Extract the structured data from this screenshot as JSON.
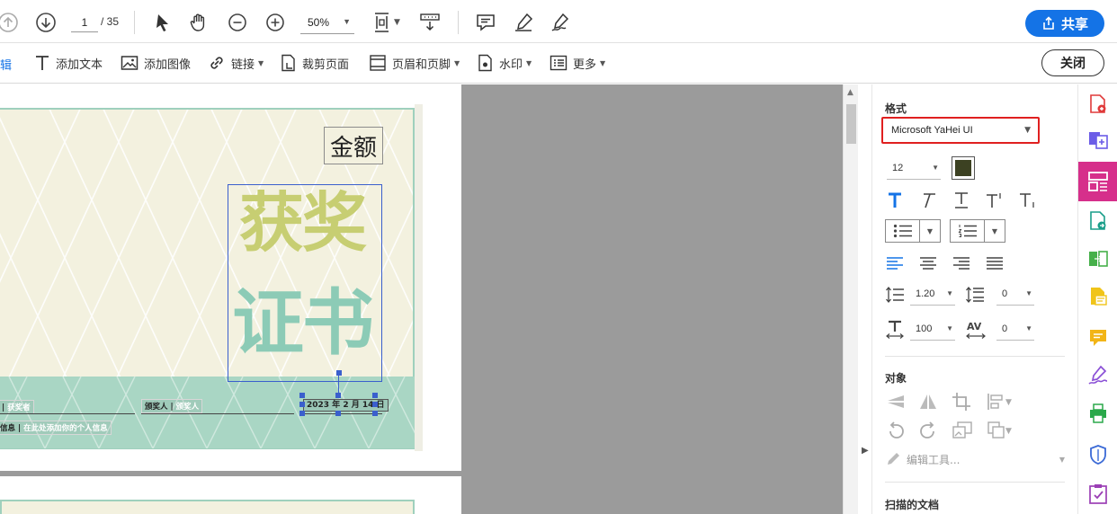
{
  "toolbar": {
    "page_current": "1",
    "page_total": "/ 35",
    "zoom": "50%",
    "share_label": "共享"
  },
  "edit_toolbar": {
    "edit_label": "编辑",
    "add_text": "添加文本",
    "add_image": "添加图像",
    "link": "链接",
    "crop_page": "裁剪页面",
    "header_footer": "页眉和页脚",
    "watermark": "水印",
    "more": "更多",
    "close": "关闭"
  },
  "certificate": {
    "amount": "金额",
    "title_line1": "获奖",
    "title_line2": "证书",
    "winner_label": "获奖者",
    "winner_value": "获奖者",
    "presenter_label": "颁奖人",
    "presenter_value": "颁奖人",
    "date": "2023 年 2 月 14 日",
    "info_label": "信息",
    "info_value": "在此处添加你的个人信息"
  },
  "format_panel": {
    "heading": "格式",
    "font_family": "Microsoft YaHei UI",
    "font_size": "12",
    "text_color": "#3c4122",
    "line_spacing": "1.20",
    "paragraph_spacing": "0",
    "horizontal_scale": "100",
    "char_spacing": "0"
  },
  "objects_panel": {
    "heading": "对象",
    "edit_tools": "编辑工具..."
  },
  "scanned_panel": {
    "heading": "扫描的文档"
  },
  "colors": {
    "accent": "#1473e6",
    "rail_active": "#d62f8b",
    "title_yellow": "#c7ce72",
    "title_green": "#8ccbb6",
    "highlight_red": "#e02020"
  }
}
